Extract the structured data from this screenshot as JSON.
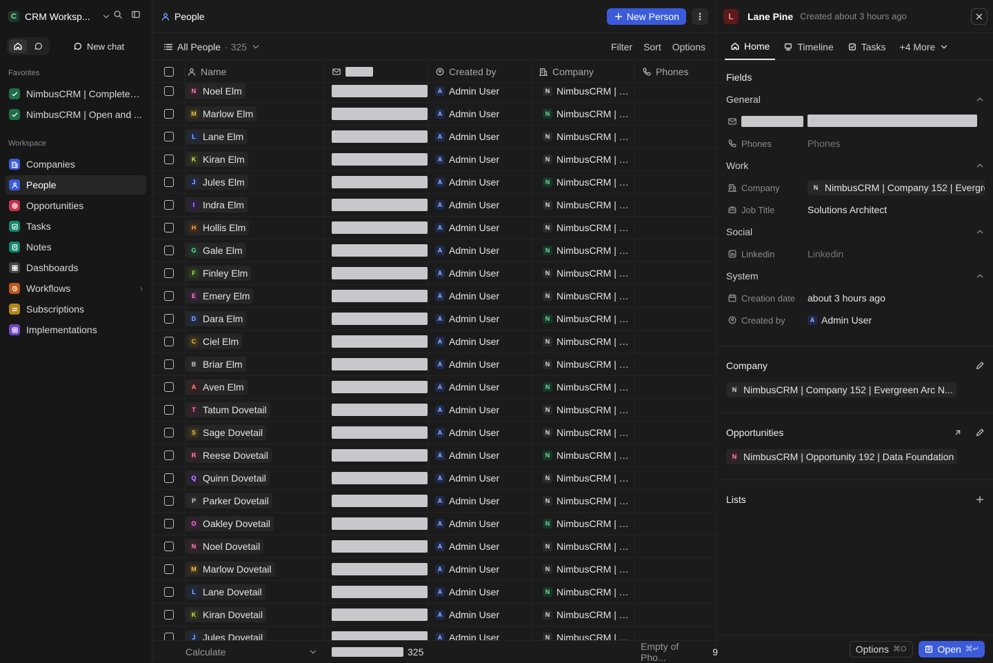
{
  "workspace": {
    "initial": "C",
    "name": "CRM Worksp..."
  },
  "sidebar": {
    "new_chat": "New chat",
    "favorites_label": "Favorites",
    "favorites": [
      {
        "label": "NimbusCRM | Completed ...",
        "color": "#1f6f4a"
      },
      {
        "label": "NimbusCRM | Open and ...",
        "color": "#1f6f4a"
      }
    ],
    "workspace_label": "Workspace",
    "items": [
      {
        "label": "Companies",
        "icon": "building-icon",
        "color": "#3b5bdb"
      },
      {
        "label": "People",
        "icon": "person-icon",
        "color": "#3b5bdb"
      },
      {
        "label": "Opportunities",
        "icon": "target-icon",
        "color": "#c2334d"
      },
      {
        "label": "Tasks",
        "icon": "checkbox-icon",
        "color": "#12866b"
      },
      {
        "label": "Notes",
        "icon": "note-icon",
        "color": "#12866b"
      },
      {
        "label": "Dashboards",
        "icon": "grid-icon",
        "color": "#444444"
      },
      {
        "label": "Workflows",
        "icon": "workflow-icon",
        "color": "#c2571a"
      },
      {
        "label": "Subscriptions",
        "icon": "repeat-icon",
        "color": "#b3861a"
      },
      {
        "label": "Implementations",
        "icon": "box-icon",
        "color": "#7048c4"
      }
    ]
  },
  "header": {
    "title": "People",
    "new_button": "New Person"
  },
  "view": {
    "name": "All People",
    "count": "· 325",
    "filter": "Filter",
    "sort": "Sort",
    "options": "Options"
  },
  "table": {
    "columns": {
      "name": "Name",
      "created_by": "Created by",
      "company": "Company",
      "phones": "Phones"
    },
    "rows": [
      {
        "initial": "N",
        "name": "Noel Elm",
        "created_by": "Admin User",
        "company": "NimbusCRM | Co...",
        "ci": "N"
      },
      {
        "initial": "M",
        "name": "Marlow Elm",
        "created_by": "Admin User",
        "company": "NimbusCRM | Co...",
        "ci": "N"
      },
      {
        "initial": "L",
        "name": "Lane Elm",
        "created_by": "Admin User",
        "company": "NimbusCRM | Co...",
        "ci": "N"
      },
      {
        "initial": "K",
        "name": "Kiran Elm",
        "created_by": "Admin User",
        "company": "NimbusCRM | Co...",
        "ci": "N"
      },
      {
        "initial": "J",
        "name": "Jules Elm",
        "created_by": "Admin User",
        "company": "NimbusCRM | Co...",
        "ci": "N"
      },
      {
        "initial": "I",
        "name": "Indra Elm",
        "created_by": "Admin User",
        "company": "NimbusCRM | Co...",
        "ci": "N"
      },
      {
        "initial": "H",
        "name": "Hollis Elm",
        "created_by": "Admin User",
        "company": "NimbusCRM | Co...",
        "ci": "N"
      },
      {
        "initial": "G",
        "name": "Gale Elm",
        "created_by": "Admin User",
        "company": "NimbusCRM | Co...",
        "ci": "N"
      },
      {
        "initial": "F",
        "name": "Finley Elm",
        "created_by": "Admin User",
        "company": "NimbusCRM | Co...",
        "ci": "N"
      },
      {
        "initial": "E",
        "name": "Emery Elm",
        "created_by": "Admin User",
        "company": "NimbusCRM | Co...",
        "ci": "N"
      },
      {
        "initial": "D",
        "name": "Dara Elm",
        "created_by": "Admin User",
        "company": "NimbusCRM | Co...",
        "ci": "N"
      },
      {
        "initial": "C",
        "name": "Ciel Elm",
        "created_by": "Admin User",
        "company": "NimbusCRM | Co...",
        "ci": "N"
      },
      {
        "initial": "B",
        "name": "Briar Elm",
        "created_by": "Admin User",
        "company": "NimbusCRM | Co...",
        "ci": "N"
      },
      {
        "initial": "A",
        "name": "Aven Elm",
        "created_by": "Admin User",
        "company": "NimbusCRM | Co...",
        "ci": "N"
      },
      {
        "initial": "T",
        "name": "Tatum Dovetail",
        "created_by": "Admin User",
        "company": "NimbusCRM | Co...",
        "ci": "N"
      },
      {
        "initial": "S",
        "name": "Sage Dovetail",
        "created_by": "Admin User",
        "company": "NimbusCRM | Co...",
        "ci": "N"
      },
      {
        "initial": "R",
        "name": "Reese Dovetail",
        "created_by": "Admin User",
        "company": "NimbusCRM | Co...",
        "ci": "N"
      },
      {
        "initial": "Q",
        "name": "Quinn Dovetail",
        "created_by": "Admin User",
        "company": "NimbusCRM | Co...",
        "ci": "N"
      },
      {
        "initial": "P",
        "name": "Parker Dovetail",
        "created_by": "Admin User",
        "company": "NimbusCRM | Co...",
        "ci": "N"
      },
      {
        "initial": "O",
        "name": "Oakley Dovetail",
        "created_by": "Admin User",
        "company": "NimbusCRM | Co...",
        "ci": "N"
      },
      {
        "initial": "N",
        "name": "Noel Dovetail",
        "created_by": "Admin User",
        "company": "NimbusCRM | Co...",
        "ci": "N"
      },
      {
        "initial": "M",
        "name": "Marlow Dovetail",
        "created_by": "Admin User",
        "company": "NimbusCRM | Co...",
        "ci": "N"
      },
      {
        "initial": "L",
        "name": "Lane Dovetail",
        "created_by": "Admin User",
        "company": "NimbusCRM | Co...",
        "ci": "N"
      },
      {
        "initial": "K",
        "name": "Kiran Dovetail",
        "created_by": "Admin User",
        "company": "NimbusCRM | Co...",
        "ci": "N"
      },
      {
        "initial": "J",
        "name": "Jules Dovetail",
        "created_by": "Admin User",
        "company": "NimbusCRM | Co...",
        "ci": "N"
      }
    ],
    "footer": {
      "calculate": "Calculate",
      "count": "325",
      "phones_summary": "Empty of Pho...",
      "phones_count": "9"
    }
  },
  "record": {
    "initial": "L",
    "name": "Lane Pine",
    "subtitle": "Created about 3 hours ago",
    "tabs": {
      "home": "Home",
      "timeline": "Timeline",
      "tasks": "Tasks",
      "more": "+4 More"
    },
    "fields_label": "Fields",
    "general_label": "General",
    "phones_label": "Phones",
    "phones_value": "Phones",
    "work_label": "Work",
    "company_label": "Company",
    "company_value": "NimbusCRM | Company 152 | Evergre",
    "jobtitle_label": "Job Title",
    "jobtitle_value": "Solutions Architect",
    "social_label": "Social",
    "linkedin_label": "Linkedin",
    "linkedin_value": "Linkedin",
    "system_label": "System",
    "creation_label": "Creation date",
    "creation_value": "about 3 hours ago",
    "createdby_label": "Created by",
    "createdby_value": "Admin User",
    "company_card_title": "Company",
    "company_card_chip": "NimbusCRM | Company 152 | Evergreen Arc N...",
    "opp_card_title": "Opportunities",
    "opp_card_chip": "NimbusCRM | Opportunity 192 | Data Foundation",
    "lists_title": "Lists",
    "options_btn": "Options",
    "options_kbd": "⌘O",
    "open_btn": "Open",
    "open_kbd": "⌘↵"
  },
  "avatar_colors": {
    "N": "#3a1e2e",
    "M": "#3d3218",
    "L": "#1e2a4a",
    "K": "#30341a",
    "J": "#1e2a4a",
    "I": "#2d1e45",
    "H": "#3d2a18",
    "G": "#1a3628",
    "F": "#2a3a1a",
    "E": "#3a1e36",
    "D": "#1e2a4a",
    "C": "#3d3218",
    "B": "#2a2a2a",
    "A": "#3a1e1e",
    "T": "#3a1e2e",
    "S": "#3d3218",
    "R": "#3a1e2e",
    "Q": "#2d1e45",
    "P": "#2a2a2a",
    "O": "#3a1e36"
  }
}
